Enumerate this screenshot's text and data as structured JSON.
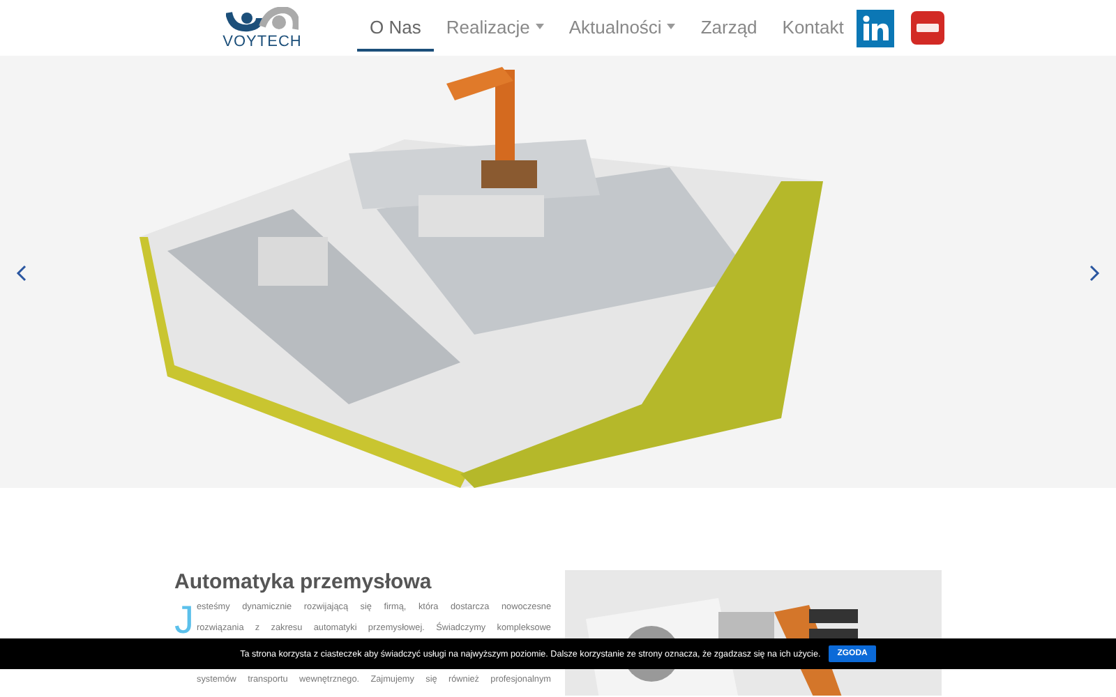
{
  "header": {
    "logo_text": "VOYTECH",
    "nav": [
      {
        "label": "O Nas",
        "selected": true,
        "dropdown": false
      },
      {
        "label": "Realizacje",
        "selected": false,
        "dropdown": true
      },
      {
        "label": "Aktualności",
        "selected": false,
        "dropdown": true
      },
      {
        "label": "Zarząd",
        "selected": false,
        "dropdown": false
      },
      {
        "label": "Kontakt",
        "selected": false,
        "dropdown": false
      }
    ]
  },
  "hero": {
    "kind": "picture"
  },
  "section": {
    "title": "Automatyka przemysłowa",
    "drop_cap": "J",
    "lines": [
      "esteśmy dynamicznie rozwijającą się firmą, która dostarcza nowoczesne",
      "rozwiązania z zakresu automatyki przemysłowej. Świadczymy kompleksowe"
    ],
    "lines_after_bar": [
      "systemów transportu wewnętrznego. Zajmujemy się również profesjonalnym"
    ],
    "image": {
      "kind": "picture"
    }
  },
  "cookie_bar": {
    "text": "Ta strona korzysta z ciasteczek aby świadczyć usługi na najwyższym poziomie. Dalsze korzystanie ze strony oznacza, że zgadzasz się na ich użycie.",
    "button": "ZGODA"
  }
}
